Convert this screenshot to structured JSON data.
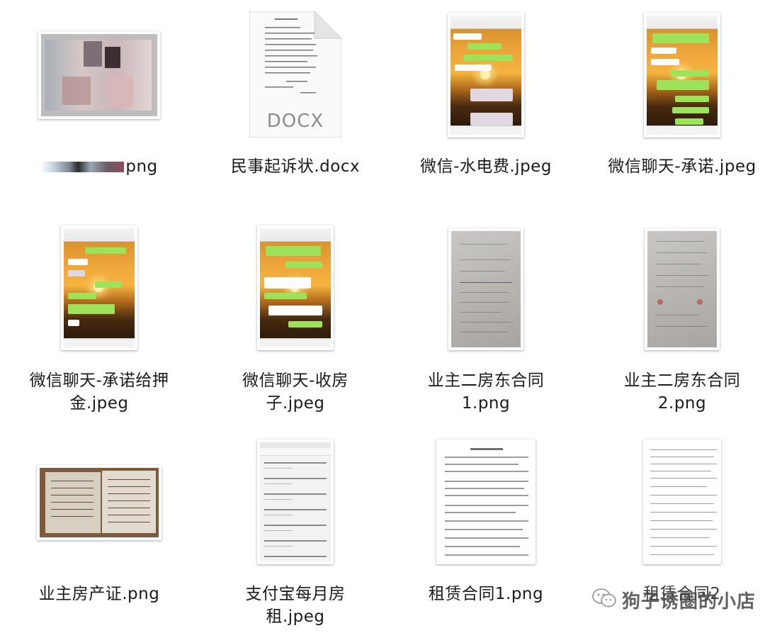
{
  "files": [
    {
      "name": "png",
      "label_prefix_blurred": true
    },
    {
      "name": "民事起诉状.docx",
      "icon_text": "DOCX"
    },
    {
      "name": "微信-水电费.jpeg"
    },
    {
      "name": "微信聊天-承诺.jpeg"
    },
    {
      "name": "微信聊天-承诺给押金.jpeg",
      "line1": "微信聊天-承诺给押",
      "line2": "金.jpeg"
    },
    {
      "name": "微信聊天-收房子.jpeg",
      "line1": "微信聊天-收房",
      "line2": "子.jpeg"
    },
    {
      "name": "业主二房东合同1.png",
      "line1": "业主二房东合同",
      "line2": "1.png"
    },
    {
      "name": "业主二房东合同2.png",
      "line1": "业主二房东合同",
      "line2": "2.png"
    },
    {
      "name": "业主房产证.png"
    },
    {
      "name": "支付宝每月房租.jpeg",
      "line1": "支付宝每月房",
      "line2": "租.jpeg"
    },
    {
      "name": "租赁合同1.png"
    },
    {
      "name": "租赁合同2.png",
      "visible": "租赁合同2"
    }
  ],
  "watermark": {
    "text": "狗子诱圈的小店",
    "icon": "wechat-icon"
  },
  "colors": {
    "chat_green": "#9de35a",
    "background": "#ffffff"
  }
}
